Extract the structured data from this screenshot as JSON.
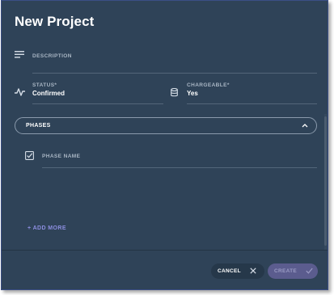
{
  "dialog": {
    "title": "New Project"
  },
  "form": {
    "description": {
      "label": "DESCRIPTION",
      "value": "",
      "icon": "notes-icon"
    },
    "status": {
      "label": "STATUS*",
      "value": "Confirmed",
      "icon": "activity-icon"
    },
    "chargeable": {
      "label": "CHARGEABLE*",
      "value": "Yes",
      "icon": "database-icon"
    }
  },
  "phases": {
    "label": "PHASES",
    "expanded": true,
    "items": [
      {
        "label": "PHASE NAME",
        "checked": true,
        "value": ""
      }
    ],
    "add_more": "+ ADD MORE"
  },
  "footer": {
    "cancel_label": "CANCEL",
    "create_label": "CREATE"
  },
  "colors": {
    "background": "#2f4358",
    "accent": "#8c8ee0",
    "create_button": "#5b5c8e"
  }
}
